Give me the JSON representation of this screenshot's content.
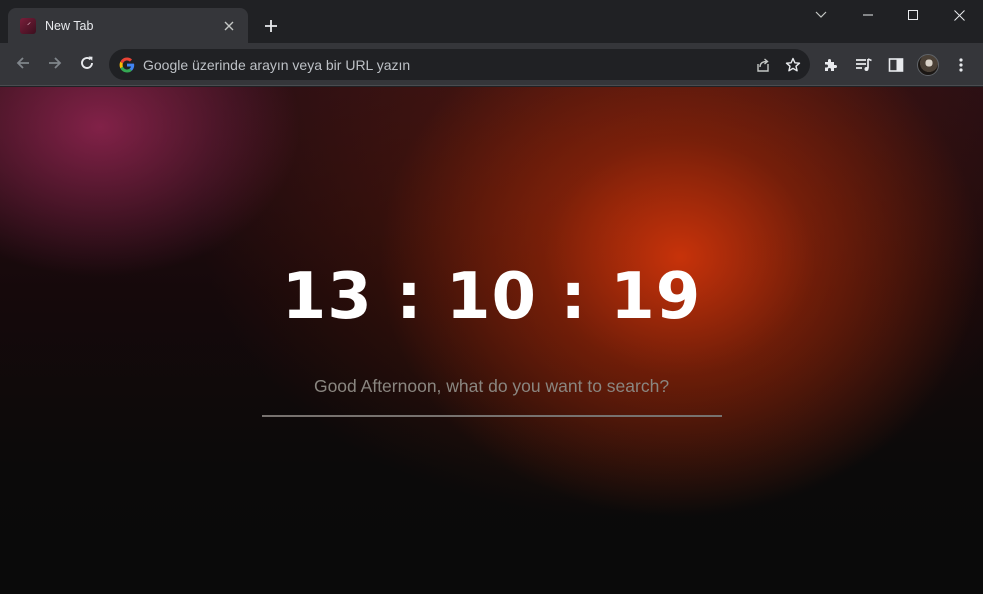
{
  "tab": {
    "title": "New Tab",
    "favicon_text": "ᐟ"
  },
  "omnibox": {
    "placeholder": "Google üzerinde arayın veya bir URL yazın"
  },
  "page": {
    "time": "13 : 10 : 19",
    "greeting": "Good Afternoon, what do you want to search?"
  },
  "icons": {
    "back": "arrow-left-icon",
    "forward": "arrow-right-icon",
    "reload": "reload-icon",
    "share": "share-icon",
    "bookmark": "star-icon",
    "extensions": "puzzle-icon",
    "media": "media-queue-icon",
    "side_panel": "side-panel-icon",
    "menu": "kebab-menu-icon"
  },
  "colors": {
    "toolbar": "#35363a",
    "titlebar": "#202124",
    "clock": "#ffffff",
    "accent_orange": "#ce340a"
  }
}
